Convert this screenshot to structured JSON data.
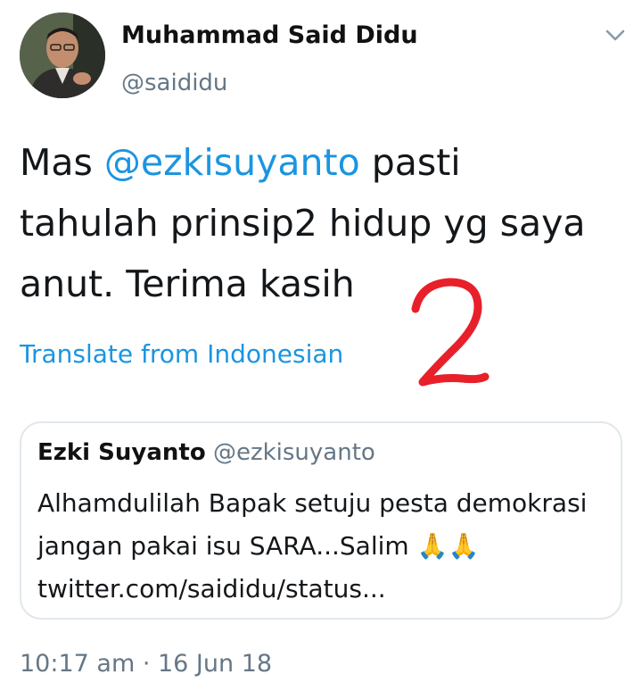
{
  "tweet": {
    "author": {
      "display_name": "Muhammad Said Didu",
      "handle": "@saididu"
    },
    "text_before_mention": "Mas ",
    "mention": "@ezkisuyanto",
    "text_after_mention": " pasti tahulah prinsip2 hidup yg saya anut. Terima kasih",
    "translate_link": "Translate from Indonesian",
    "quoted_tweet": {
      "display_name": "Ezki Suyanto",
      "handle": "@ezkisuyanto",
      "text": "Alhamdulilah Bapak setuju pesta demokrasi jangan pakai isu SARA...Salim ",
      "emoji": "🙏🙏",
      "link": "twitter.com/saididu/status..."
    },
    "timestamp": "10:17 am · 16 Jun 18"
  },
  "overlay": {
    "annotation_number": "2",
    "annotation_color": "#e8202a"
  },
  "colors": {
    "link": "#1b95e0",
    "secondary_text": "#657786",
    "border": "#e1e8ed"
  },
  "icons": {
    "menu": "chevron-down-icon"
  }
}
